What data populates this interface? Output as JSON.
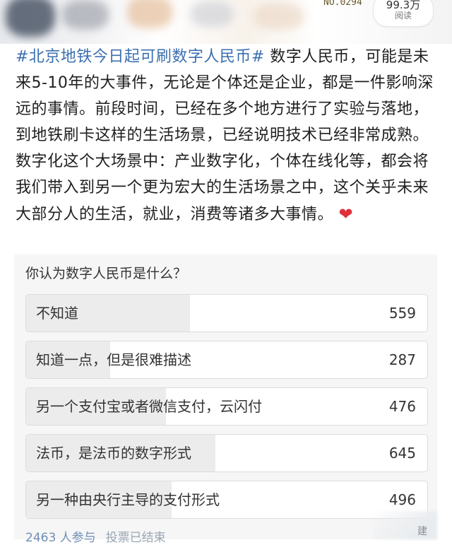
{
  "header": {
    "serial_text": "NO.0294",
    "read_count": "99.3万",
    "read_label": "阅读"
  },
  "post": {
    "hashtag": "#北京地铁今日起可刷数字人民币#",
    "body": " 数字人民币，可能是未来5-10年的大事件，无论是个体还是企业，都是一件影响深远的事情。前段时间，已经在多个地方进行了实验与落地，到地铁刷卡这样的生活场景，已经说明技术已经非常成熟。数字化这个大场景中：产业数字化，个体在线化等，都会将我们带入到另一个更为宏大的生活场景之中，这个关乎未来大部分人的生活，就业，消费等诸多大事情。",
    "emoji_icon": "red-heart-emoji"
  },
  "poll": {
    "question": "你认为数字人民币是什么？",
    "options": [
      {
        "label": "不知道",
        "count": 559,
        "count_text": "559"
      },
      {
        "label": "知道一点，但是很难描述",
        "count": 287,
        "count_text": "287"
      },
      {
        "label": "另一个支付宝或者微信支付，云闪付",
        "count": 476,
        "count_text": "476"
      },
      {
        "label": "法币，是法币的数字形式",
        "count": 645,
        "count_text": "645"
      },
      {
        "label": "另一种由央行主导的支付形式",
        "count": 496,
        "count_text": "496"
      }
    ],
    "participants": "2463 人参与",
    "status": "投票已结束"
  },
  "watermark": {
    "text": "建"
  },
  "colors": {
    "hashtag": "#3b6fb0",
    "poll_bg": "#f6f6f6",
    "bar_fill": "#ececec",
    "heart": "#e0303a",
    "footer_link": "#6f8fb7"
  }
}
